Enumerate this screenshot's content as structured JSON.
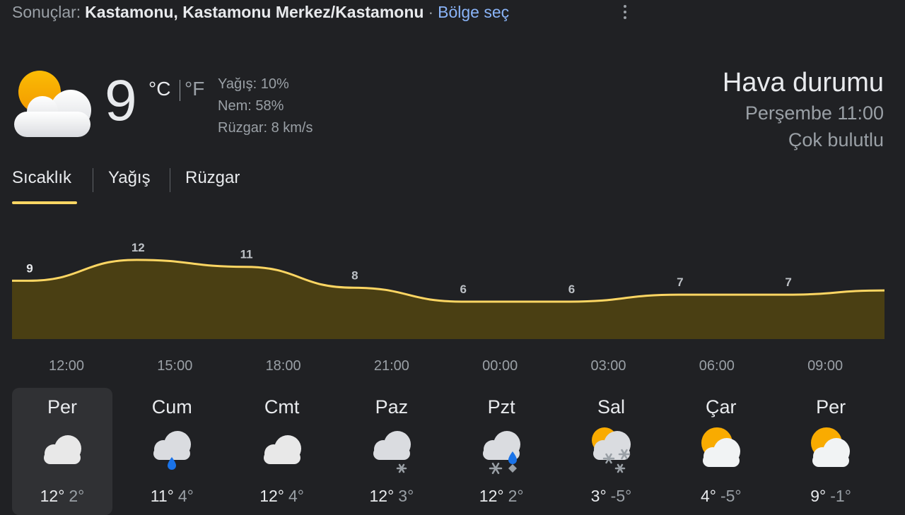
{
  "header": {
    "results_label": "Sonuçlar:",
    "location": "Kastamonu, Kastamonu Merkez/Kastamonu",
    "separator": "·",
    "region_link": "Bölge seç"
  },
  "current": {
    "temp": "9",
    "unit_c": "°C",
    "unit_f": "°F",
    "precip": "Yağış: 10%",
    "humidity": "Nem: 58%",
    "wind": "Rüzgar: 8 km/s",
    "icon": "partly-cloudy-icon"
  },
  "summary": {
    "title": "Hava durumu",
    "time": "Perşembe 11:00",
    "condition": "Çok bulutlu"
  },
  "tabs": [
    {
      "label": "Sıcaklık",
      "active": true
    },
    {
      "label": "Yağış",
      "active": false
    },
    {
      "label": "Rüzgar",
      "active": false
    }
  ],
  "colors": {
    "accent": "#fdd663",
    "area_fill": "#4a3f13",
    "background": "#202124",
    "selected_card": "#303134",
    "rain_drop": "#1a73e8"
  },
  "chart_data": {
    "type": "area",
    "x": [
      "12:00",
      "15:00",
      "18:00",
      "21:00",
      "00:00",
      "03:00",
      "06:00",
      "09:00"
    ],
    "values": [
      9,
      12,
      11,
      8,
      6,
      6,
      7,
      7
    ],
    "ylim": [
      0,
      16
    ]
  },
  "days": [
    {
      "name": "Per",
      "high": "12°",
      "low": "2°",
      "icon": "cloudy-icon",
      "selected": true
    },
    {
      "name": "Cum",
      "high": "11°",
      "low": "4°",
      "icon": "rain-icon",
      "selected": false
    },
    {
      "name": "Cmt",
      "high": "12°",
      "low": "4°",
      "icon": "cloudy-icon",
      "selected": false
    },
    {
      "name": "Paz",
      "high": "12°",
      "low": "3°",
      "icon": "snow-icon",
      "selected": false
    },
    {
      "name": "Pzt",
      "high": "12°",
      "low": "2°",
      "icon": "sleet-icon",
      "selected": false
    },
    {
      "name": "Sal",
      "high": "3°",
      "low": "-5°",
      "icon": "partly-cloudy-snow-icon",
      "selected": false
    },
    {
      "name": "Çar",
      "high": "4°",
      "low": "-5°",
      "icon": "partly-cloudy-icon",
      "selected": false
    },
    {
      "name": "Per",
      "high": "9°",
      "low": "-1°",
      "icon": "partly-cloudy-icon",
      "selected": false
    }
  ]
}
